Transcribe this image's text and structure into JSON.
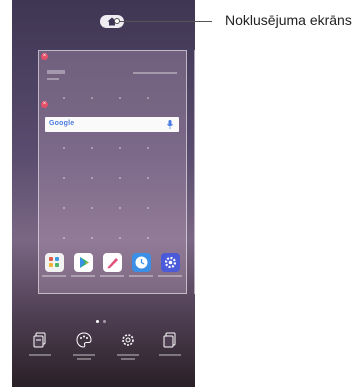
{
  "callout": {
    "label": "Noklusējuma ekrāns"
  },
  "home_screen": {
    "search_widget": {
      "logo": "Google"
    },
    "colors": {
      "home_pill": "#efecf2",
      "remove_badge": "#e2506a",
      "gallery_icon": "#f2f2f2",
      "play_store_icon": "#ffffff",
      "notes_icon": "#ffffff",
      "clock_icon": "#3c8fe6",
      "settings_icon": "#4a5ad8"
    },
    "apps": [
      {
        "icon": "apps-folder-icon"
      },
      {
        "icon": "play-store-icon"
      },
      {
        "icon": "notes-pen-icon"
      },
      {
        "icon": "clock-icon"
      },
      {
        "icon": "settings-gear-icon"
      }
    ],
    "bottom_actions": [
      {
        "icon": "widgets-icon"
      },
      {
        "icon": "wallpaper-theme-icon"
      },
      {
        "icon": "home-screen-settings-icon"
      },
      {
        "icon": "app-trash-icon"
      }
    ]
  }
}
